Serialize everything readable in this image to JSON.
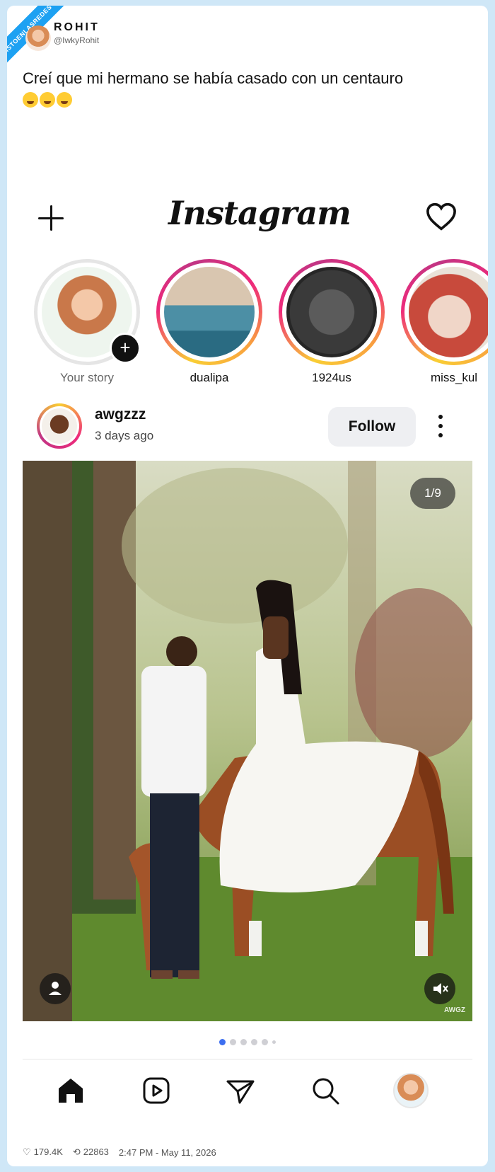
{
  "watermark_site": "VISTOENLASREDES .com",
  "tweet": {
    "name": "ROHIT",
    "handle": "@IwkyRohit",
    "text": "Creí que mi hermano se había casado con un centauro",
    "emojis": [
      "loudly-crying-face",
      "loudly-crying-face",
      "face-with-tears-of-joy"
    ]
  },
  "instagram": {
    "logo": "Instagram",
    "stories": [
      {
        "label": "Your story",
        "icon": "add-story-icon"
      },
      {
        "label": "dualipa"
      },
      {
        "label": "1924us"
      },
      {
        "label": "miss_kul"
      }
    ],
    "post": {
      "username": "awgzzz",
      "time": "3 days ago",
      "follow_label": "Follow",
      "counter": "1/9",
      "photo_watermark": "AWGZ",
      "carousel_position": 1,
      "carousel_total": 9
    },
    "nav": [
      "home-icon",
      "reels-icon",
      "direct-icon",
      "search-icon",
      "profile-avatar"
    ]
  },
  "footer": {
    "likes": "179.4K",
    "retweets": "22863",
    "timestamp": "2:47 PM - May 11, 2026"
  },
  "colors": {
    "page_bg": "#cfe7f7",
    "ribbon": "#1da1f2",
    "active_dot": "#3c6ef0",
    "story_ring": [
      "#f9ce34",
      "#ee2a7b",
      "#c13584"
    ]
  }
}
